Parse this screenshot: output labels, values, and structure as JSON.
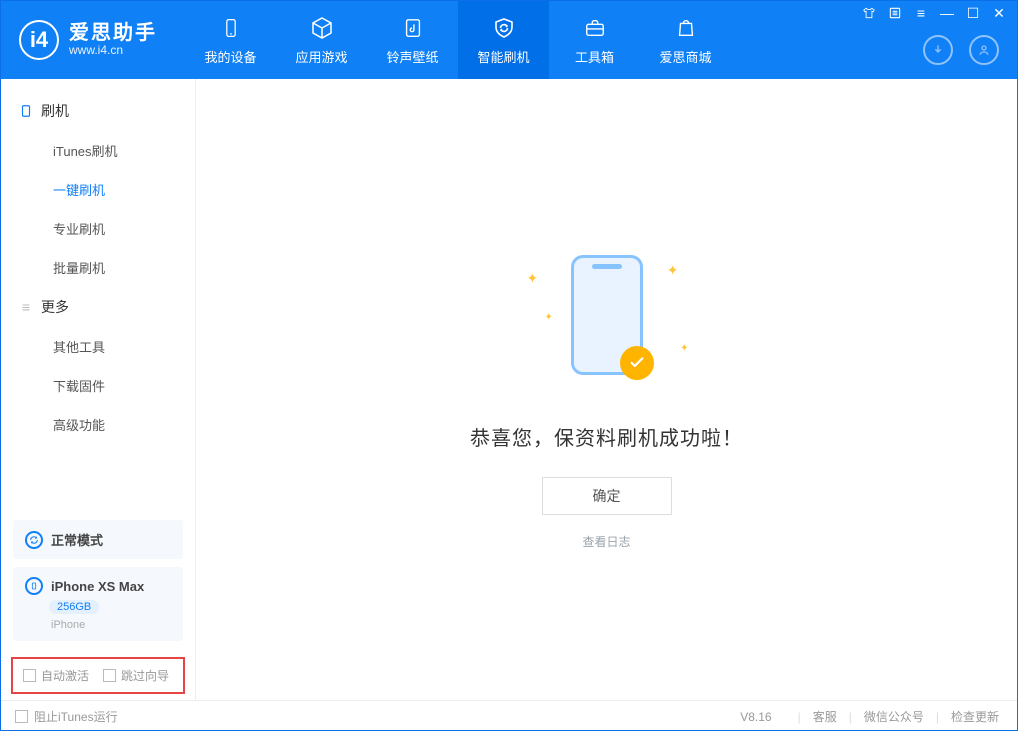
{
  "app": {
    "name": "爱思助手",
    "url": "www.i4.cn"
  },
  "nav": {
    "items": [
      {
        "label": "我的设备",
        "name": "nav-my-device"
      },
      {
        "label": "应用游戏",
        "name": "nav-apps-games"
      },
      {
        "label": "铃声壁纸",
        "name": "nav-ringtone-wallpaper"
      },
      {
        "label": "智能刷机",
        "name": "nav-smart-flash"
      },
      {
        "label": "工具箱",
        "name": "nav-toolbox"
      },
      {
        "label": "爱思商城",
        "name": "nav-store"
      }
    ]
  },
  "sidebar": {
    "sections": [
      {
        "title": "刷机",
        "items": [
          "iTunes刷机",
          "一键刷机",
          "专业刷机",
          "批量刷机"
        ],
        "active_index": 1
      },
      {
        "title": "更多",
        "items": [
          "其他工具",
          "下载固件",
          "高级功能"
        ]
      }
    ]
  },
  "device_mode": {
    "label": "正常模式"
  },
  "device": {
    "name": "iPhone XS Max",
    "capacity": "256GB",
    "type": "iPhone"
  },
  "options": {
    "auto_activate": "自动激活",
    "skip_guide": "跳过向导"
  },
  "main": {
    "success_msg": "恭喜您，保资料刷机成功啦！",
    "ok_label": "确定",
    "view_log": "查看日志"
  },
  "footer": {
    "block_itunes": "阻止iTunes运行",
    "version": "V8.16",
    "links": [
      "客服",
      "微信公众号",
      "检查更新"
    ]
  },
  "colors": {
    "primary": "#1080f6",
    "accent": "#ffb400"
  }
}
